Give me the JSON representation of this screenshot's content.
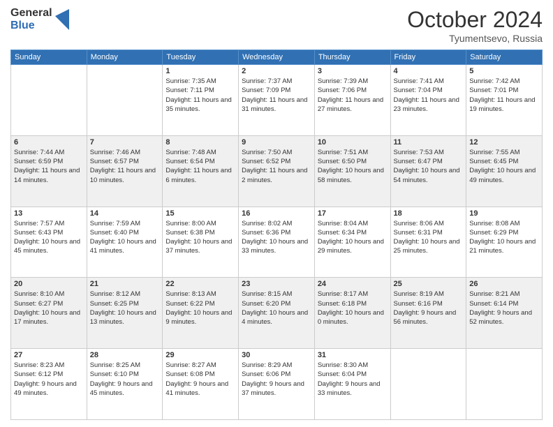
{
  "header": {
    "logo_general": "General",
    "logo_blue": "Blue",
    "month_title": "October 2024",
    "location": "Tyumentsevo, Russia"
  },
  "weekdays": [
    "Sunday",
    "Monday",
    "Tuesday",
    "Wednesday",
    "Thursday",
    "Friday",
    "Saturday"
  ],
  "weeks": [
    [
      {
        "day": "",
        "info": ""
      },
      {
        "day": "",
        "info": ""
      },
      {
        "day": "1",
        "info": "Sunrise: 7:35 AM\nSunset: 7:11 PM\nDaylight: 11 hours and 35 minutes."
      },
      {
        "day": "2",
        "info": "Sunrise: 7:37 AM\nSunset: 7:09 PM\nDaylight: 11 hours and 31 minutes."
      },
      {
        "day": "3",
        "info": "Sunrise: 7:39 AM\nSunset: 7:06 PM\nDaylight: 11 hours and 27 minutes."
      },
      {
        "day": "4",
        "info": "Sunrise: 7:41 AM\nSunset: 7:04 PM\nDaylight: 11 hours and 23 minutes."
      },
      {
        "day": "5",
        "info": "Sunrise: 7:42 AM\nSunset: 7:01 PM\nDaylight: 11 hours and 19 minutes."
      }
    ],
    [
      {
        "day": "6",
        "info": "Sunrise: 7:44 AM\nSunset: 6:59 PM\nDaylight: 11 hours and 14 minutes."
      },
      {
        "day": "7",
        "info": "Sunrise: 7:46 AM\nSunset: 6:57 PM\nDaylight: 11 hours and 10 minutes."
      },
      {
        "day": "8",
        "info": "Sunrise: 7:48 AM\nSunset: 6:54 PM\nDaylight: 11 hours and 6 minutes."
      },
      {
        "day": "9",
        "info": "Sunrise: 7:50 AM\nSunset: 6:52 PM\nDaylight: 11 hours and 2 minutes."
      },
      {
        "day": "10",
        "info": "Sunrise: 7:51 AM\nSunset: 6:50 PM\nDaylight: 10 hours and 58 minutes."
      },
      {
        "day": "11",
        "info": "Sunrise: 7:53 AM\nSunset: 6:47 PM\nDaylight: 10 hours and 54 minutes."
      },
      {
        "day": "12",
        "info": "Sunrise: 7:55 AM\nSunset: 6:45 PM\nDaylight: 10 hours and 49 minutes."
      }
    ],
    [
      {
        "day": "13",
        "info": "Sunrise: 7:57 AM\nSunset: 6:43 PM\nDaylight: 10 hours and 45 minutes."
      },
      {
        "day": "14",
        "info": "Sunrise: 7:59 AM\nSunset: 6:40 PM\nDaylight: 10 hours and 41 minutes."
      },
      {
        "day": "15",
        "info": "Sunrise: 8:00 AM\nSunset: 6:38 PM\nDaylight: 10 hours and 37 minutes."
      },
      {
        "day": "16",
        "info": "Sunrise: 8:02 AM\nSunset: 6:36 PM\nDaylight: 10 hours and 33 minutes."
      },
      {
        "day": "17",
        "info": "Sunrise: 8:04 AM\nSunset: 6:34 PM\nDaylight: 10 hours and 29 minutes."
      },
      {
        "day": "18",
        "info": "Sunrise: 8:06 AM\nSunset: 6:31 PM\nDaylight: 10 hours and 25 minutes."
      },
      {
        "day": "19",
        "info": "Sunrise: 8:08 AM\nSunset: 6:29 PM\nDaylight: 10 hours and 21 minutes."
      }
    ],
    [
      {
        "day": "20",
        "info": "Sunrise: 8:10 AM\nSunset: 6:27 PM\nDaylight: 10 hours and 17 minutes."
      },
      {
        "day": "21",
        "info": "Sunrise: 8:12 AM\nSunset: 6:25 PM\nDaylight: 10 hours and 13 minutes."
      },
      {
        "day": "22",
        "info": "Sunrise: 8:13 AM\nSunset: 6:22 PM\nDaylight: 10 hours and 9 minutes."
      },
      {
        "day": "23",
        "info": "Sunrise: 8:15 AM\nSunset: 6:20 PM\nDaylight: 10 hours and 4 minutes."
      },
      {
        "day": "24",
        "info": "Sunrise: 8:17 AM\nSunset: 6:18 PM\nDaylight: 10 hours and 0 minutes."
      },
      {
        "day": "25",
        "info": "Sunrise: 8:19 AM\nSunset: 6:16 PM\nDaylight: 9 hours and 56 minutes."
      },
      {
        "day": "26",
        "info": "Sunrise: 8:21 AM\nSunset: 6:14 PM\nDaylight: 9 hours and 52 minutes."
      }
    ],
    [
      {
        "day": "27",
        "info": "Sunrise: 8:23 AM\nSunset: 6:12 PM\nDaylight: 9 hours and 49 minutes."
      },
      {
        "day": "28",
        "info": "Sunrise: 8:25 AM\nSunset: 6:10 PM\nDaylight: 9 hours and 45 minutes."
      },
      {
        "day": "29",
        "info": "Sunrise: 8:27 AM\nSunset: 6:08 PM\nDaylight: 9 hours and 41 minutes."
      },
      {
        "day": "30",
        "info": "Sunrise: 8:29 AM\nSunset: 6:06 PM\nDaylight: 9 hours and 37 minutes."
      },
      {
        "day": "31",
        "info": "Sunrise: 8:30 AM\nSunset: 6:04 PM\nDaylight: 9 hours and 33 minutes."
      },
      {
        "day": "",
        "info": ""
      },
      {
        "day": "",
        "info": ""
      }
    ]
  ]
}
